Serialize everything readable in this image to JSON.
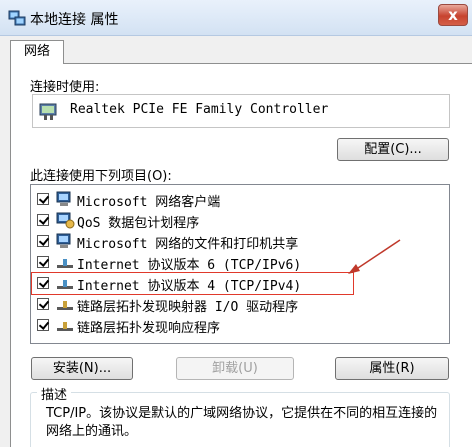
{
  "window": {
    "title": "本地连接 属性",
    "close_label": "x"
  },
  "tabs": [
    {
      "label": "网络",
      "active": true
    }
  ],
  "connect_using": {
    "label": "连接时使用:",
    "adapter_name": "Realtek PCIe FE Family Controller",
    "configure_button": "配置(C)..."
  },
  "items_section": {
    "label": "此连接使用下列项目(O):",
    "items": [
      {
        "label": "Microsoft 网络客户端",
        "checked": true,
        "icon": "network-client-icon"
      },
      {
        "label": "QoS 数据包计划程序",
        "checked": true,
        "icon": "network-service-icon"
      },
      {
        "label": "Microsoft 网络的文件和打印机共享",
        "checked": true,
        "icon": "network-client-icon"
      },
      {
        "label": "Internet 协议版本 6 (TCP/IPv6)",
        "checked": true,
        "icon": "protocol-icon"
      },
      {
        "label": "Internet 协议版本 4 (TCP/IPv4)",
        "checked": true,
        "icon": "protocol-icon",
        "highlighted": true
      },
      {
        "label": "链路层拓扑发现映射器 I/O 驱动程序",
        "checked": true,
        "icon": "protocol-icon"
      },
      {
        "label": "链路层拓扑发现响应程序",
        "checked": true,
        "icon": "protocol-icon"
      }
    ]
  },
  "buttons": {
    "install": "安装(N)...",
    "uninstall": "卸载(U)",
    "properties": "属性(R)"
  },
  "description": {
    "title": "描述",
    "text": "TCP/IP。该协议是默认的广域网络协议，它提供在不同的相互连接的网络上的通讯。"
  },
  "colors": {
    "highlight_border": "#e0392b",
    "arrow": "#c0392b"
  }
}
